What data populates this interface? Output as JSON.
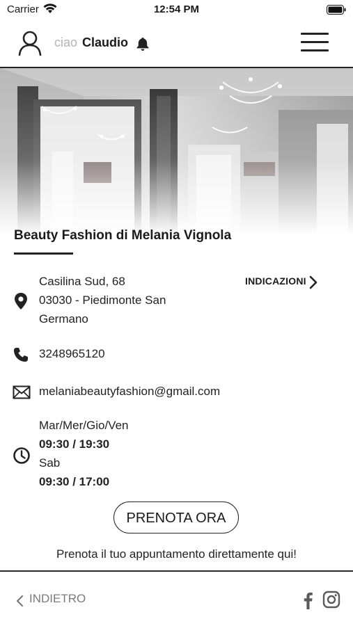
{
  "status_bar": {
    "carrier": "Carrier",
    "time": "12:54 PM"
  },
  "topnav": {
    "greeting_prefix": "ciao",
    "user_name": "Claudio"
  },
  "salon": {
    "name": "Beauty Fashion di Melania Vignola",
    "address_line1": "Casilina Sud, 68",
    "address_line2": "03030 - Piedimonte San",
    "address_line3": "Germano",
    "directions_label": "INDICAZIONI",
    "phone": "3248965120",
    "email": "melaniabeautyfashion@gmail.com",
    "hours": [
      {
        "days": "Mar/Mer/Gio/Ven",
        "time": "09:30 / 19:30"
      },
      {
        "days": "Sab",
        "time": "09:30 / 17:00"
      }
    ]
  },
  "booking": {
    "button_label": "PRENOTA ORA",
    "caption": "Prenota il tuo appuntamento direttamente qui!"
  },
  "footer": {
    "back_label": "INDIETRO"
  },
  "icons": [
    "wifi-icon",
    "battery-icon",
    "user-icon",
    "bell-icon",
    "hamburger-menu-icon",
    "location-pin-icon",
    "chevron-right-icon",
    "phone-icon",
    "mail-icon",
    "clock-icon",
    "chevron-left-icon",
    "facebook-icon",
    "instagram-icon"
  ]
}
